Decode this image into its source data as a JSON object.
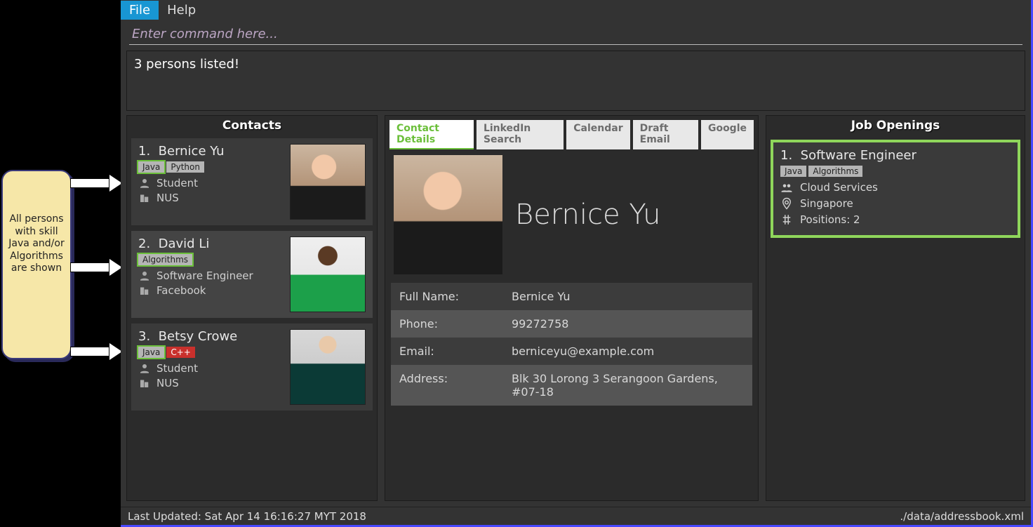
{
  "menu": {
    "file": "File",
    "help": "Help"
  },
  "command": {
    "placeholder": "Enter command here..."
  },
  "output": "3 persons listed!",
  "callout": "All persons with skill Java and/or Algorithms are shown",
  "contacts": {
    "title": "Contacts",
    "items": [
      {
        "index": "1.",
        "name": "Bernice Yu",
        "tags": [
          {
            "label": "Java",
            "style": "hl-green"
          },
          {
            "label": "Python",
            "style": ""
          }
        ],
        "role": "Student",
        "org": "NUS"
      },
      {
        "index": "2.",
        "name": "David Li",
        "tags": [
          {
            "label": "Algorithms",
            "style": "hl-green"
          }
        ],
        "role": "Software Engineer",
        "org": "Facebook"
      },
      {
        "index": "3.",
        "name": "Betsy Crowe",
        "tags": [
          {
            "label": "Java",
            "style": "hl-green"
          },
          {
            "label": "C++",
            "style": "hl-red"
          }
        ],
        "role": "Student",
        "org": "NUS"
      }
    ]
  },
  "tabs": {
    "items": [
      "Contact Details",
      "LinkedIn Search",
      "Calendar",
      "Draft Email",
      "Google"
    ],
    "active": 0
  },
  "details": {
    "display_name": "Bernice Yu",
    "rows": [
      {
        "label": "Full Name:",
        "value": "Bernice Yu"
      },
      {
        "label": "Phone:",
        "value": "99272758"
      },
      {
        "label": "Email:",
        "value": "berniceyu@example.com"
      },
      {
        "label": "Address:",
        "value": "Blk 30 Lorong 3 Serangoon Gardens, #07-18"
      }
    ]
  },
  "jobs": {
    "title": "Job Openings",
    "items": [
      {
        "index": "1.",
        "name": "Software Engineer",
        "tags": [
          "Java",
          "Algorithms"
        ],
        "company": "Cloud Services",
        "location": "Singapore",
        "positions": "Positions: 2"
      }
    ]
  },
  "status": {
    "left": "Last Updated: Sat Apr 14 16:16:27 MYT 2018",
    "right": "./data/addressbook.xml"
  }
}
